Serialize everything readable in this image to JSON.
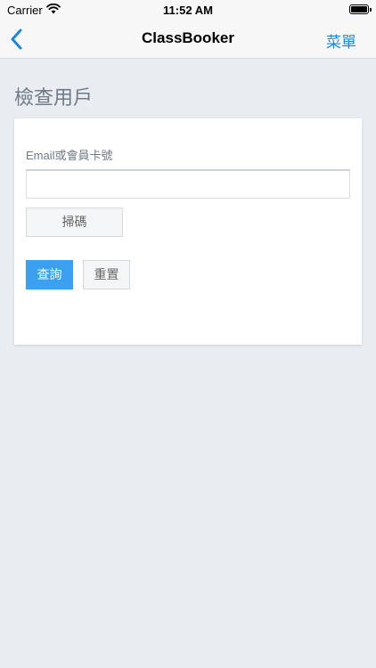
{
  "status_bar": {
    "carrier": "Carrier",
    "time": "11:52 AM"
  },
  "nav": {
    "title": "ClassBooker",
    "menu_label": "菜單",
    "accent_color": "#1a87e0"
  },
  "page": {
    "title": "檢查用戶"
  },
  "form": {
    "email_label": "Email或會員卡號",
    "email_value": "",
    "scan_label": "掃碼",
    "query_label": "查詢",
    "reset_label": "重置"
  },
  "colors": {
    "primary_button": "#3aa0ef",
    "background": "#e9edf2"
  }
}
